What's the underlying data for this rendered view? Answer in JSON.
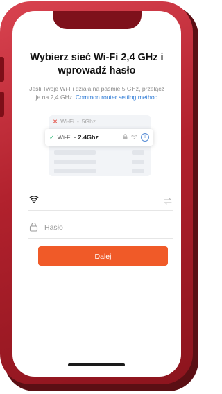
{
  "screen": {
    "title_line1": "Wybierz sieć Wi-Fi 2,4 GHz i",
    "title_line2": "wprowadź hasło",
    "subtitle_part1": "Jeśli Twoje Wi-Fi działa na paśmie 5 GHz, przełącz",
    "subtitle_part2": "je na 2,4 GHz.",
    "router_link": "Common router setting method"
  },
  "illustration": {
    "faded_network": {
      "label": "Wi-Fi",
      "separator": "-",
      "band": "5Ghz"
    },
    "selected_network": {
      "label": "Wi-Fi",
      "separator": "-",
      "band": "2.4Ghz"
    }
  },
  "form": {
    "wifi_name_value": "",
    "password_placeholder": "Hasło"
  },
  "actions": {
    "next_label": "Dalej"
  },
  "colors": {
    "accent": "#f05a28",
    "link": "#2d7bd6",
    "frame": "#b1212d"
  },
  "icons": [
    "wifi-icon",
    "lock-icon",
    "eye-off-icon",
    "check-icon",
    "x-icon",
    "info-icon"
  ]
}
